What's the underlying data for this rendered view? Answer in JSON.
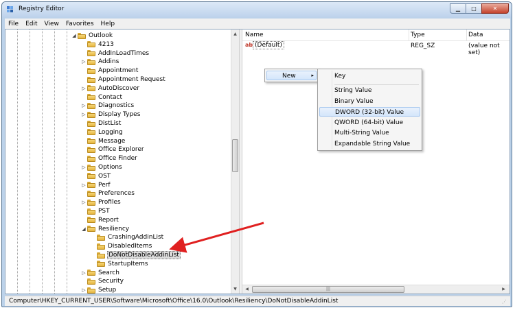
{
  "window": {
    "title": "Registry Editor",
    "controls": {
      "minimize": "▁",
      "maximize": "□",
      "close": "✕"
    }
  },
  "menubar": [
    "File",
    "Edit",
    "View",
    "Favorites",
    "Help"
  ],
  "tree": {
    "items": [
      {
        "label": "Outlook",
        "level": 0,
        "expander": "expanded"
      },
      {
        "label": "4213",
        "level": 1,
        "expander": "none"
      },
      {
        "label": "AddInLoadTimes",
        "level": 1,
        "expander": "none"
      },
      {
        "label": "Addins",
        "level": 1,
        "expander": "collapsed"
      },
      {
        "label": "Appointment",
        "level": 1,
        "expander": "none"
      },
      {
        "label": "Appointment Request",
        "level": 1,
        "expander": "none"
      },
      {
        "label": "AutoDiscover",
        "level": 1,
        "expander": "collapsed"
      },
      {
        "label": "Contact",
        "level": 1,
        "expander": "none"
      },
      {
        "label": "Diagnostics",
        "level": 1,
        "expander": "collapsed"
      },
      {
        "label": "Display Types",
        "level": 1,
        "expander": "collapsed"
      },
      {
        "label": "DistList",
        "level": 1,
        "expander": "none"
      },
      {
        "label": "Logging",
        "level": 1,
        "expander": "none"
      },
      {
        "label": "Message",
        "level": 1,
        "expander": "none"
      },
      {
        "label": "Office Explorer",
        "level": 1,
        "expander": "none"
      },
      {
        "label": "Office Finder",
        "level": 1,
        "expander": "none"
      },
      {
        "label": "Options",
        "level": 1,
        "expander": "collapsed"
      },
      {
        "label": "OST",
        "level": 1,
        "expander": "none"
      },
      {
        "label": "Perf",
        "level": 1,
        "expander": "collapsed"
      },
      {
        "label": "Preferences",
        "level": 1,
        "expander": "none"
      },
      {
        "label": "Profiles",
        "level": 1,
        "expander": "collapsed"
      },
      {
        "label": "PST",
        "level": 1,
        "expander": "none"
      },
      {
        "label": "Report",
        "level": 1,
        "expander": "none"
      },
      {
        "label": "Resiliency",
        "level": 1,
        "expander": "expanded"
      },
      {
        "label": "CrashingAddinList",
        "level": 2,
        "expander": "none"
      },
      {
        "label": "DisabledItems",
        "level": 2,
        "expander": "none"
      },
      {
        "label": "DoNotDisableAddinList",
        "level": 2,
        "expander": "none",
        "selected": true
      },
      {
        "label": "StartupItems",
        "level": 2,
        "expander": "none"
      },
      {
        "label": "Search",
        "level": 1,
        "expander": "collapsed"
      },
      {
        "label": "Security",
        "level": 1,
        "expander": "none"
      },
      {
        "label": "Setup",
        "level": 1,
        "expander": "collapsed"
      }
    ]
  },
  "list": {
    "columns": [
      "Name",
      "Type",
      "Data"
    ],
    "rows": [
      {
        "icon": "ab",
        "name": "(Default)",
        "type": "REG_SZ",
        "data": "(value not set)"
      }
    ]
  },
  "context_menu": {
    "new_label": "New",
    "submenu": [
      "Key",
      "String Value",
      "Binary Value",
      "DWORD (32-bit) Value",
      "QWORD (64-bit) Value",
      "Multi-String Value",
      "Expandable String Value"
    ],
    "highlighted": "DWORD (32-bit) Value"
  },
  "statusbar": {
    "path": "Computer\\HKEY_CURRENT_USER\\Software\\Microsoft\\Office\\16.0\\Outlook\\Resiliency\\DoNotDisableAddinList"
  },
  "colors": {
    "annotation_arrow": "#e02020",
    "selection": "#dcdcdc",
    "menu_highlight": "#d4e6fb"
  },
  "icons": {
    "app": "registry-cube-icon",
    "folder": "folder-icon",
    "string_value": "ab-string-icon",
    "submenu_arrow": "▸",
    "expanded": "◢",
    "collapsed": "▷"
  }
}
